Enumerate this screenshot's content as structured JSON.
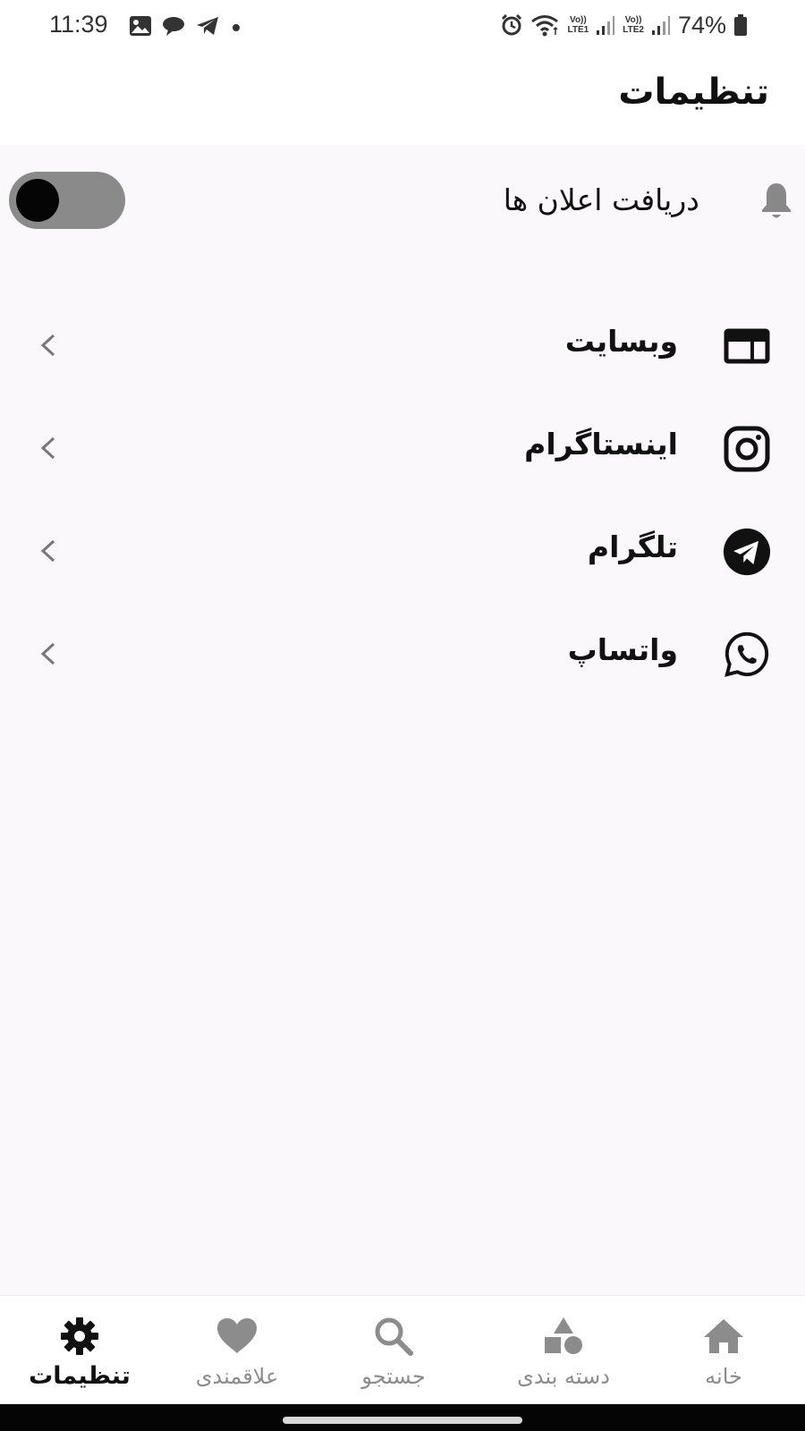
{
  "status_bar": {
    "time": "11:39",
    "battery": "74%",
    "sim1_tag_top": "Vo))",
    "sim1_tag_bottom": "LTE1",
    "sim2_tag_top": "Vo))",
    "sim2_tag_bottom": "LTE2",
    "icons": [
      "gallery-icon",
      "chat-icon",
      "telegram-icon",
      "dot-icon",
      "alarm-icon",
      "wifi-icon",
      "signal-icon",
      "battery-icon"
    ]
  },
  "header": {
    "title": "تنظیمات"
  },
  "notifications": {
    "label": "دریافت اعلان ها",
    "icon": "bell-icon",
    "enabled": false
  },
  "links": [
    {
      "label": "وبسایت",
      "icon": "website-icon"
    },
    {
      "label": "اینستاگرام",
      "icon": "instagram-icon"
    },
    {
      "label": "تلگرام",
      "icon": "telegram-icon"
    },
    {
      "label": "واتساپ",
      "icon": "whatsapp-icon"
    }
  ],
  "bottom_nav": [
    {
      "label": "خانه",
      "icon": "home-icon",
      "active": false
    },
    {
      "label": "دسته بندی",
      "icon": "category-icon",
      "active": false
    },
    {
      "label": "جستجو",
      "icon": "search-icon",
      "active": false
    },
    {
      "label": "علاقمندی",
      "icon": "heart-icon",
      "active": false
    },
    {
      "label": "تنظیمات",
      "icon": "gear-icon",
      "active": true
    }
  ],
  "colors": {
    "background": "#fbf8fc",
    "text": "#111111",
    "nav_inactive": "#8c8c8c",
    "toggle_track": "#8a8a8a",
    "toggle_knob": "#050505"
  }
}
